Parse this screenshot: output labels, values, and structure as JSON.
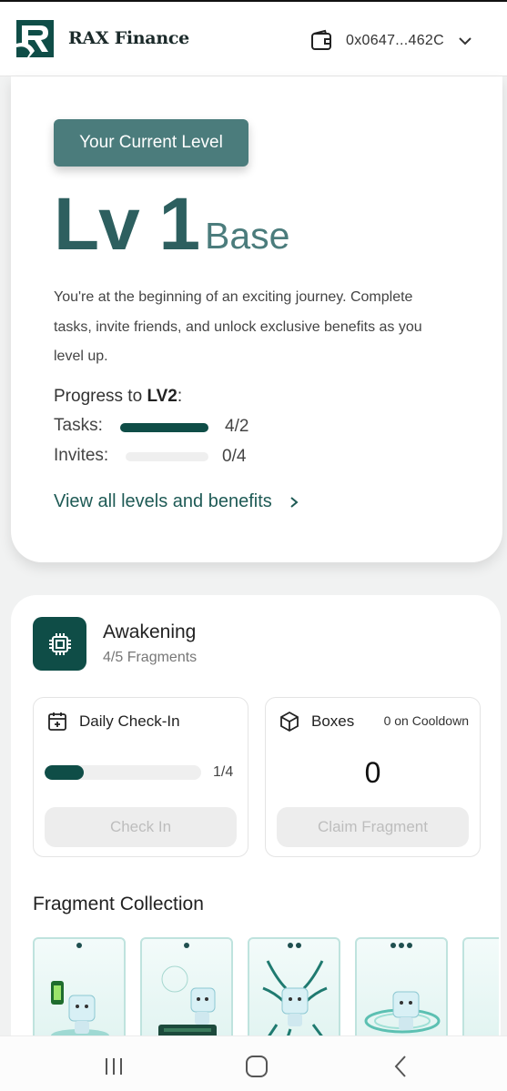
{
  "header": {
    "brand": "RAX Finance",
    "wallet_address": "0x0647...462C",
    "icons": [
      "logo-mark",
      "wallet-icon",
      "chevron-down-icon"
    ]
  },
  "level_card": {
    "badge": "Your Current Level",
    "level": "Lv 1",
    "level_name": "Base",
    "description": "You're at the beginning of an exciting journey. Complete tasks, invite friends, and unlock exclusive benefits as you level up.",
    "progress_prefix": "Progress to ",
    "progress_target": "LV2",
    "progress_suffix": ":",
    "tasks_label": "Tasks:",
    "tasks_value": "4/2",
    "tasks_fill": 1.0,
    "invites_label": "Invites:",
    "invites_value": "0/4",
    "invites_fill": 0.0,
    "view_link": "View all levels and benefits"
  },
  "awakening": {
    "title": "Awakening",
    "subtitle": "4/5 Fragments",
    "checkin": {
      "label": "Daily Check-In",
      "progress_text": "1/4",
      "progress_fill": 0.25,
      "button": "Check In"
    },
    "boxes": {
      "label": "Boxes",
      "cooldown": "0 on Cooldown",
      "count": "0",
      "button": "Claim Fragment"
    },
    "fragment_title": "Fragment Collection",
    "fragments": [
      {
        "name": "fragment-battery",
        "dots": 1
      },
      {
        "name": "fragment-chip",
        "dots": 1
      },
      {
        "name": "fragment-roots",
        "dots": 2
      },
      {
        "name": "fragment-portal",
        "dots": 3
      }
    ]
  },
  "colors": {
    "accent": "#0f4d47",
    "badge": "#4b7c7c",
    "level_text": "#2d5f5f"
  }
}
